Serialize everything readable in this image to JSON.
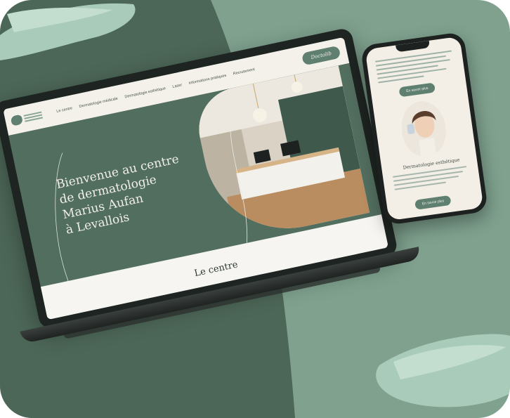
{
  "colors": {
    "background": "#7fa18e",
    "dark_panel": "#4c6657",
    "brush_stroke": "#a9cbb9",
    "site_green": "#526e5f",
    "site_cream": "#f4f1ea"
  },
  "laptop": {
    "nav": {
      "logo": "logo-icon",
      "items": [
        "Le centre",
        "Dermatologie médicale",
        "Dermatologie esthétique",
        "Laser",
        "Informations pratiques",
        "Recrutement"
      ],
      "cta": "Doctolib"
    },
    "hero": {
      "title_lines": [
        "Bienvenue au centre",
        "de dermatologie",
        "Marius Aufan",
        "à Levallois"
      ]
    },
    "section_title": "Le centre"
  },
  "phone": {
    "button_top": "En savoir plus",
    "caption": "Dermatologie esthétique",
    "button_bottom": "En savoir plus"
  }
}
